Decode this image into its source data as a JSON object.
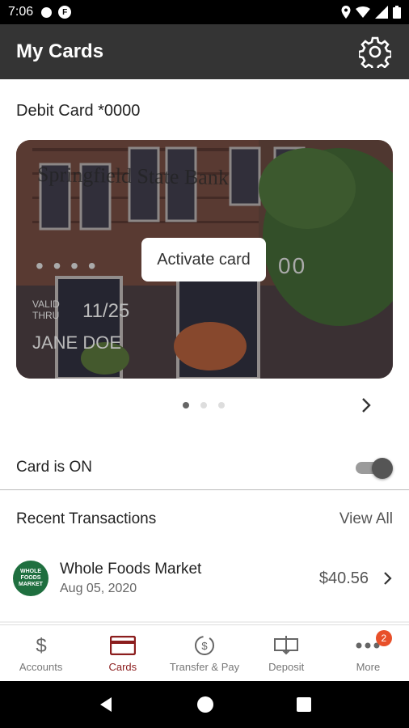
{
  "status_bar": {
    "time": "7:06"
  },
  "app_bar": {
    "title": "My Cards"
  },
  "card_section": {
    "title": "Debit Card *0000",
    "bank_name": "Springfield State Bank",
    "masked_number": "• • • •",
    "last_digits": "00",
    "valid_label_line1": "VALID",
    "valid_label_line2": "THRU",
    "expiry": "11/25",
    "holder": "JANE DOE",
    "activate_label": "Activate card",
    "pager": {
      "count": 3,
      "active": 0
    }
  },
  "card_status": {
    "label": "Card is ON",
    "on": true
  },
  "recent": {
    "title": "Recent Transactions",
    "view_all": "View All",
    "transactions": [
      {
        "logo_text": "WHOLE FOODS MARKET",
        "merchant": "Whole Foods Market",
        "date": "Aug 05, 2020",
        "amount": "$40.56"
      }
    ]
  },
  "bottom_nav": [
    {
      "label": "Accounts",
      "icon": "dollar-icon"
    },
    {
      "label": "Cards",
      "icon": "card-icon",
      "active": true
    },
    {
      "label": "Transfer & Pay",
      "icon": "transfer-icon"
    },
    {
      "label": "Deposit",
      "icon": "deposit-icon"
    },
    {
      "label": "More",
      "icon": "more-icon",
      "badge": "2"
    }
  ],
  "colors": {
    "app_bar": "#343434",
    "active_nav": "#8b1d1d",
    "badge": "#e8502a"
  }
}
